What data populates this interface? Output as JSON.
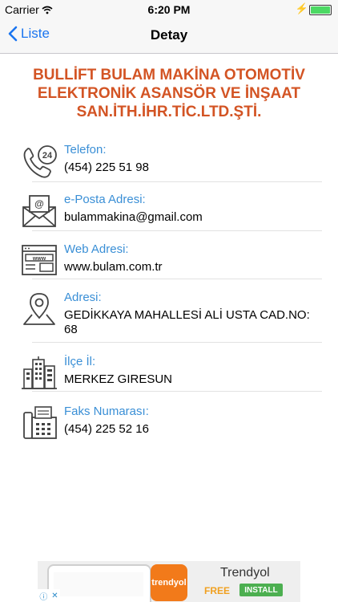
{
  "status": {
    "carrier": "Carrier",
    "time": "6:20 PM"
  },
  "nav": {
    "back_label": "Liste",
    "title": "Detay"
  },
  "company": {
    "line1": "BULLİFT BULAM MAKİNA OTOMOTİV",
    "line2": "ELEKTRONİK ASANSÖR VE İNŞAAT",
    "line3": "SAN.İTH.İHR.TİC.LTD.ŞTİ."
  },
  "rows": [
    {
      "icon": "phone-24-icon",
      "label": "Telefon:",
      "value": "(454) 225 51 98"
    },
    {
      "icon": "mail-icon",
      "label": "e-Posta Adresi:",
      "value": "bulammakina@gmail.com"
    },
    {
      "icon": "web-icon",
      "label": "Web Adresi:",
      "value": "www.bulam.com.tr"
    },
    {
      "icon": "location-icon",
      "label": "Adresi:",
      "value": "GEDİKKAYA MAHALLESİ ALİ USTA CAD.NO: 68"
    },
    {
      "icon": "city-icon",
      "label": "İlçe İl:",
      "value": "MERKEZ GIRESUN"
    },
    {
      "icon": "fax-icon",
      "label": "Faks Numarası:",
      "value": "(454) 225 52 16"
    }
  ],
  "ad": {
    "logo_text": "trendyol",
    "app_name": "Trendyol",
    "price": "FREE",
    "cta": "INSTALL"
  },
  "colors": {
    "accent": "#1b75f0",
    "label": "#3a8fd6",
    "title": "#d35424"
  }
}
